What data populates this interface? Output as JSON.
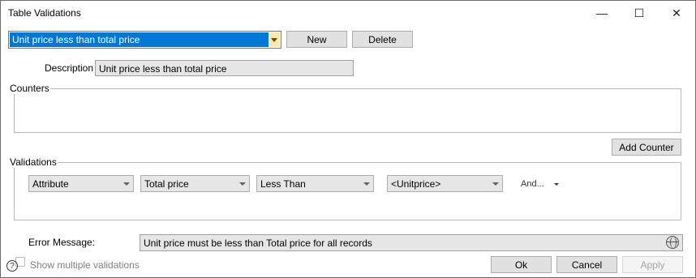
{
  "window": {
    "title": "Table Validations",
    "minimize_glyph": "—",
    "maximize_glyph": "☐",
    "close_glyph": "✕"
  },
  "toolbar": {
    "selected_validation": "Unit price less than total price",
    "new_label": "New",
    "delete_label": "Delete"
  },
  "description": {
    "label": "Description",
    "value": "Unit price less than total price"
  },
  "counters": {
    "legend": "Counters",
    "add_counter_label": "Add Counter"
  },
  "validations": {
    "legend": "Validations",
    "row": {
      "type": "Attribute",
      "field": "Total price",
      "operator": "Less Than",
      "compare_to": "<Unitprice>",
      "and_label": "And..."
    }
  },
  "error": {
    "label": "Error Message:",
    "value": "Unit price must be less than Total price for all records"
  },
  "footer": {
    "help_glyph": "?",
    "show_multiple_label": "Show multiple validations",
    "show_multiple_checked": false,
    "ok_label": "Ok",
    "cancel_label": "Cancel",
    "apply_label": "Apply"
  },
  "icons": {
    "combo_arrow": "chevron-down-icon",
    "globe": "globe-icon",
    "help": "help-icon"
  },
  "colors": {
    "selection": "#0078d7",
    "combo_arrow_bg": "#fde8b0"
  }
}
